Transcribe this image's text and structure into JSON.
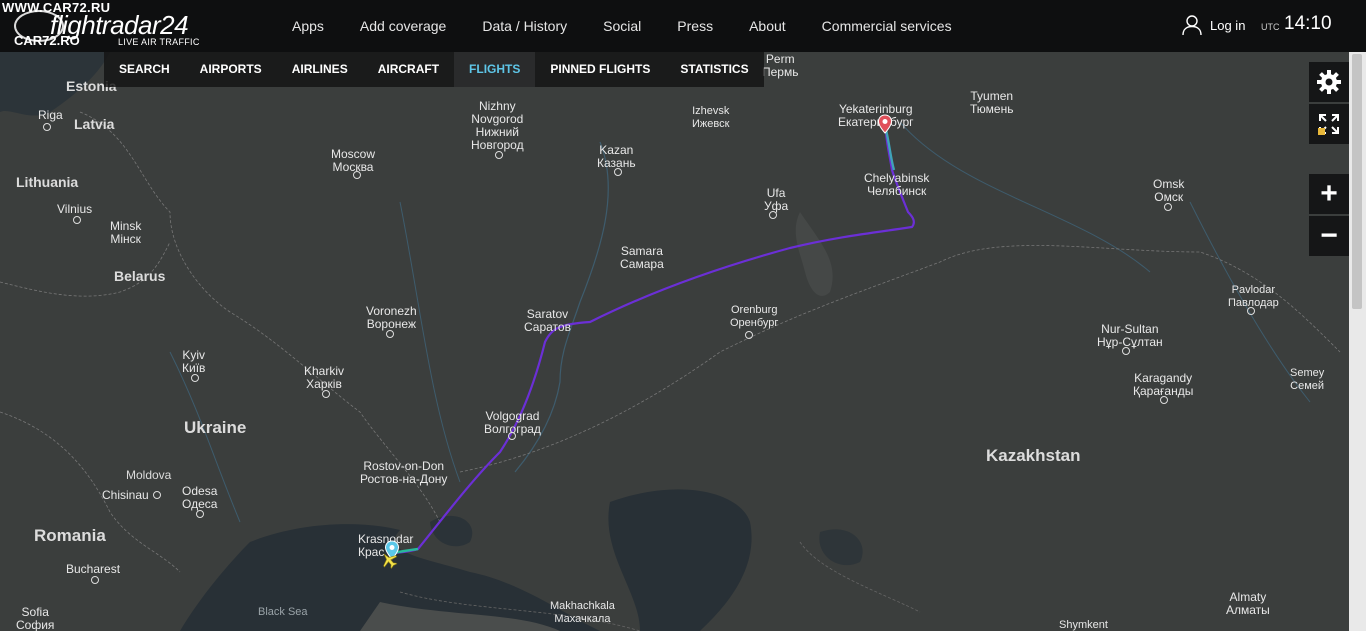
{
  "watermark": {
    "top": "WWW.CAR72.RU",
    "bottom": "CAR72.RO"
  },
  "logo": {
    "name": "flightradar24",
    "tagline": "LIVE AIR TRAFFIC"
  },
  "topnav": {
    "items": [
      "Apps",
      "Add coverage",
      "Data / History",
      "Social",
      "Press",
      "About",
      "Commercial services"
    ]
  },
  "account": {
    "login_label": "Log in"
  },
  "clock": {
    "utc_label": "UTC",
    "time": "14:10"
  },
  "subnav": {
    "items": [
      "SEARCH",
      "AIRPORTS",
      "AIRLINES",
      "AIRCRAFT",
      "FLIGHTS",
      "PINNED FLIGHTS",
      "STATISTICS"
    ],
    "active": "FLIGHTS"
  },
  "map_controls": {
    "settings_icon": "gear-icon",
    "fullscreen_icon": "expand-icon",
    "zoom_in": "+",
    "zoom_out": "−"
  },
  "map": {
    "countries": {
      "estonia": "Estonia",
      "latvia": "Latvia",
      "lithuania": "Lithuania",
      "belarus": "Belarus",
      "ukraine": "Ukraine",
      "moldova": "Moldova",
      "romania": "Romania",
      "kazakhstan": "Kazakhstan"
    },
    "seas": {
      "black_sea": "Black Sea"
    },
    "cities": {
      "riga": "Riga",
      "vilnius": "Vilnius",
      "minsk": {
        "en": "Minsk",
        "local": "Мінск"
      },
      "moscow": {
        "en": "Moscow",
        "local": "Москва"
      },
      "nizhny": {
        "en": "Nizhny\nNovgorod",
        "local": "Нижний\nНовгород"
      },
      "kazan": {
        "en": "Kazan",
        "local": "Казань"
      },
      "izhevsk": {
        "en": "Izhevsk",
        "local": "Ижевск"
      },
      "perm": {
        "en": "Perm",
        "local": "Пермь"
      },
      "yekaterinburg": {
        "en": "Yekaterinburg",
        "local": "Екатеринбург"
      },
      "tyumen": {
        "en": "Tyumen",
        "local": "Тюмень"
      },
      "chelyabinsk": {
        "en": "Chelyabinsk",
        "local": "Челябинск"
      },
      "ufa": {
        "en": "Ufa",
        "local": "Уфа"
      },
      "omsk": {
        "en": "Omsk",
        "local": "Омск"
      },
      "samara": {
        "en": "Samara",
        "local": "Самара"
      },
      "pavlodar": {
        "en": "Pavlodar",
        "local": "Павлодар"
      },
      "saratov": {
        "en": "Saratov",
        "local": "Саратов"
      },
      "orenburg": {
        "en": "Orenburg",
        "local": "Оренбург"
      },
      "voronezh": {
        "en": "Voronezh",
        "local": "Воронеж"
      },
      "nursultan": {
        "en": "Nur-Sultan",
        "local": "Нұр-Сұлтан"
      },
      "kyiv": {
        "en": "Kyiv",
        "local": "Київ"
      },
      "kharkiv": {
        "en": "Kharkiv",
        "local": "Харків"
      },
      "semey": {
        "en": "Semey",
        "local": "Семей"
      },
      "karagandy": {
        "en": "Karagandy",
        "local": "Қарағанды"
      },
      "volgograd": {
        "en": "Volgograd",
        "local": "Волгоград"
      },
      "rostov": {
        "en": "Rostov-on-Don",
        "local": "Ростов-на-Дону"
      },
      "chisinau": "Chisinau",
      "odesa": {
        "en": "Odesa",
        "local": "Одеса"
      },
      "krasnodar": {
        "en": "Krasnodar",
        "local": "Крас"
      },
      "bucharest": "Bucharest",
      "sofia": {
        "en": "Sofia",
        "local": "София"
      },
      "makhachkala": {
        "en": "Makhachkala",
        "local": "Махачкала"
      },
      "shymkent": "Shymkent",
      "almaty": {
        "en": "Almaty",
        "local": "Алматы"
      }
    },
    "flight": {
      "origin_marker_color": "#5bc8e8",
      "destination_marker_color": "#e0505a",
      "aircraft_color": "#f3e24a",
      "track_color": "#6b2fd6"
    }
  }
}
